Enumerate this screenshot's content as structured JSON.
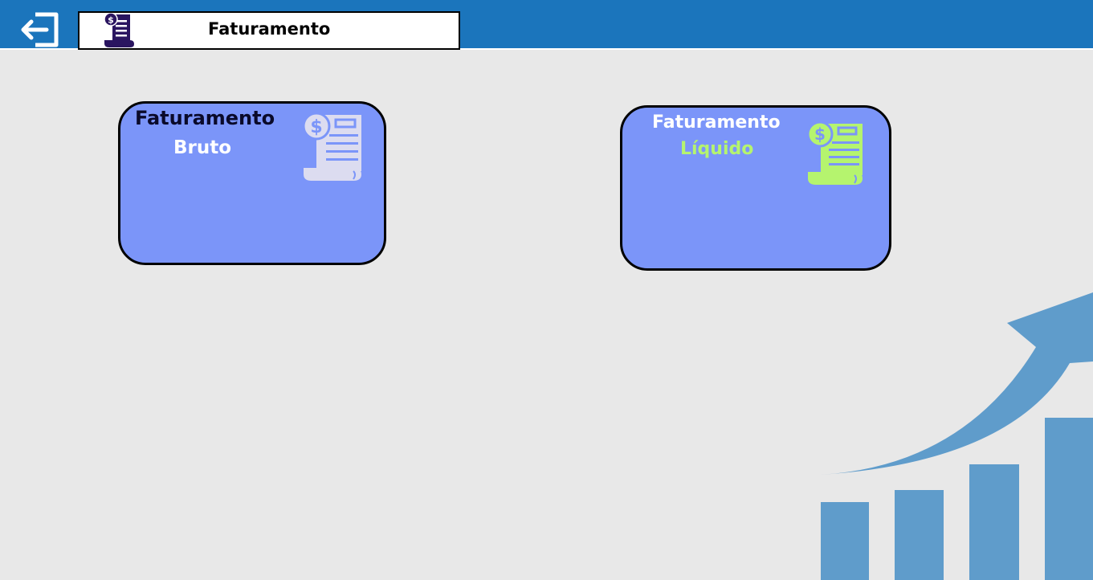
{
  "header": {
    "title": "Faturamento",
    "back_icon": "exit-arrow-icon",
    "title_icon": "invoice-dollar-icon"
  },
  "cards": {
    "bruto": {
      "line1": "Faturamento",
      "line2": "Bruto",
      "icon": "invoice-dollar-icon"
    },
    "liquido": {
      "line1": "Faturamento",
      "line2": "Líquido",
      "icon": "invoice-dollar-icon"
    }
  },
  "decoration": {
    "icon": "growth-chart-icon"
  },
  "colors": {
    "header_bg": "#1b75bc",
    "page_bg": "#e8e8e8",
    "card_bg": "#7b95f9",
    "liquido_accent": "#b5f46e",
    "chart_blue": "#5f9ccb"
  }
}
